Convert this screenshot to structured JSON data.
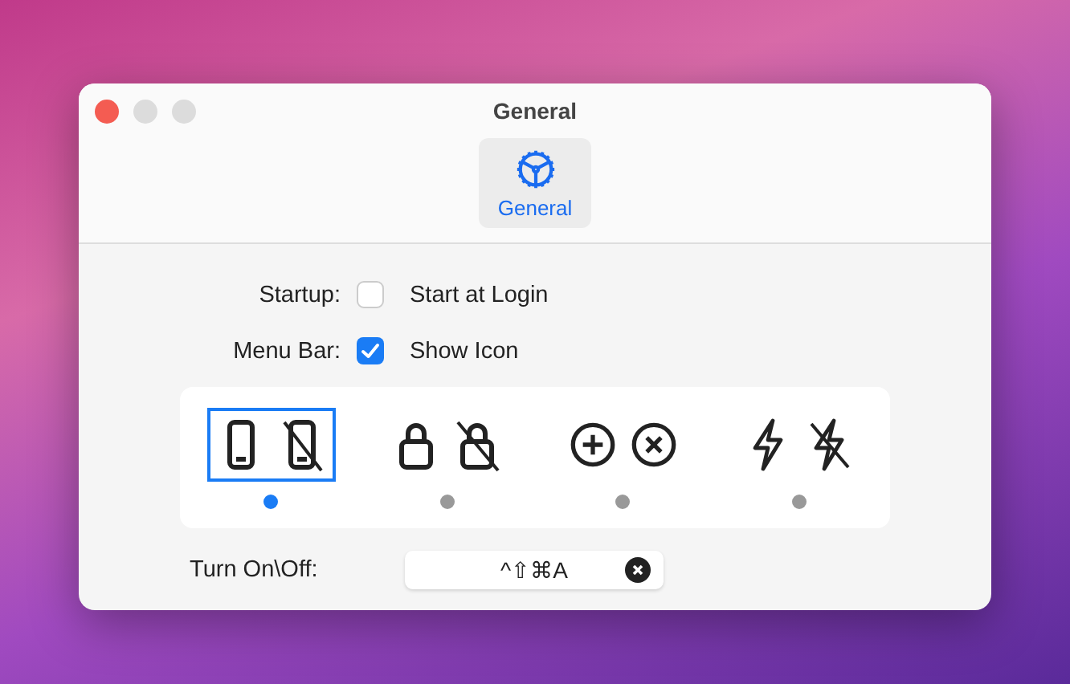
{
  "window": {
    "title": "General"
  },
  "toolbar": [
    {
      "label": "General",
      "selected": true
    }
  ],
  "options": [
    {
      "label": "Startup:",
      "text": "Start at Login",
      "checked": false
    },
    {
      "label": "Menu Bar:",
      "text": "Show Icon",
      "checked": true
    }
  ],
  "icon_styles": [
    {
      "kind": "phone",
      "selected": true
    },
    {
      "kind": "lock",
      "selected": false
    },
    {
      "kind": "circle",
      "selected": false
    },
    {
      "kind": "bolt",
      "selected": false
    }
  ],
  "shortcut": {
    "label": "Turn On\\Off:",
    "value": "^⇧⌘A"
  }
}
